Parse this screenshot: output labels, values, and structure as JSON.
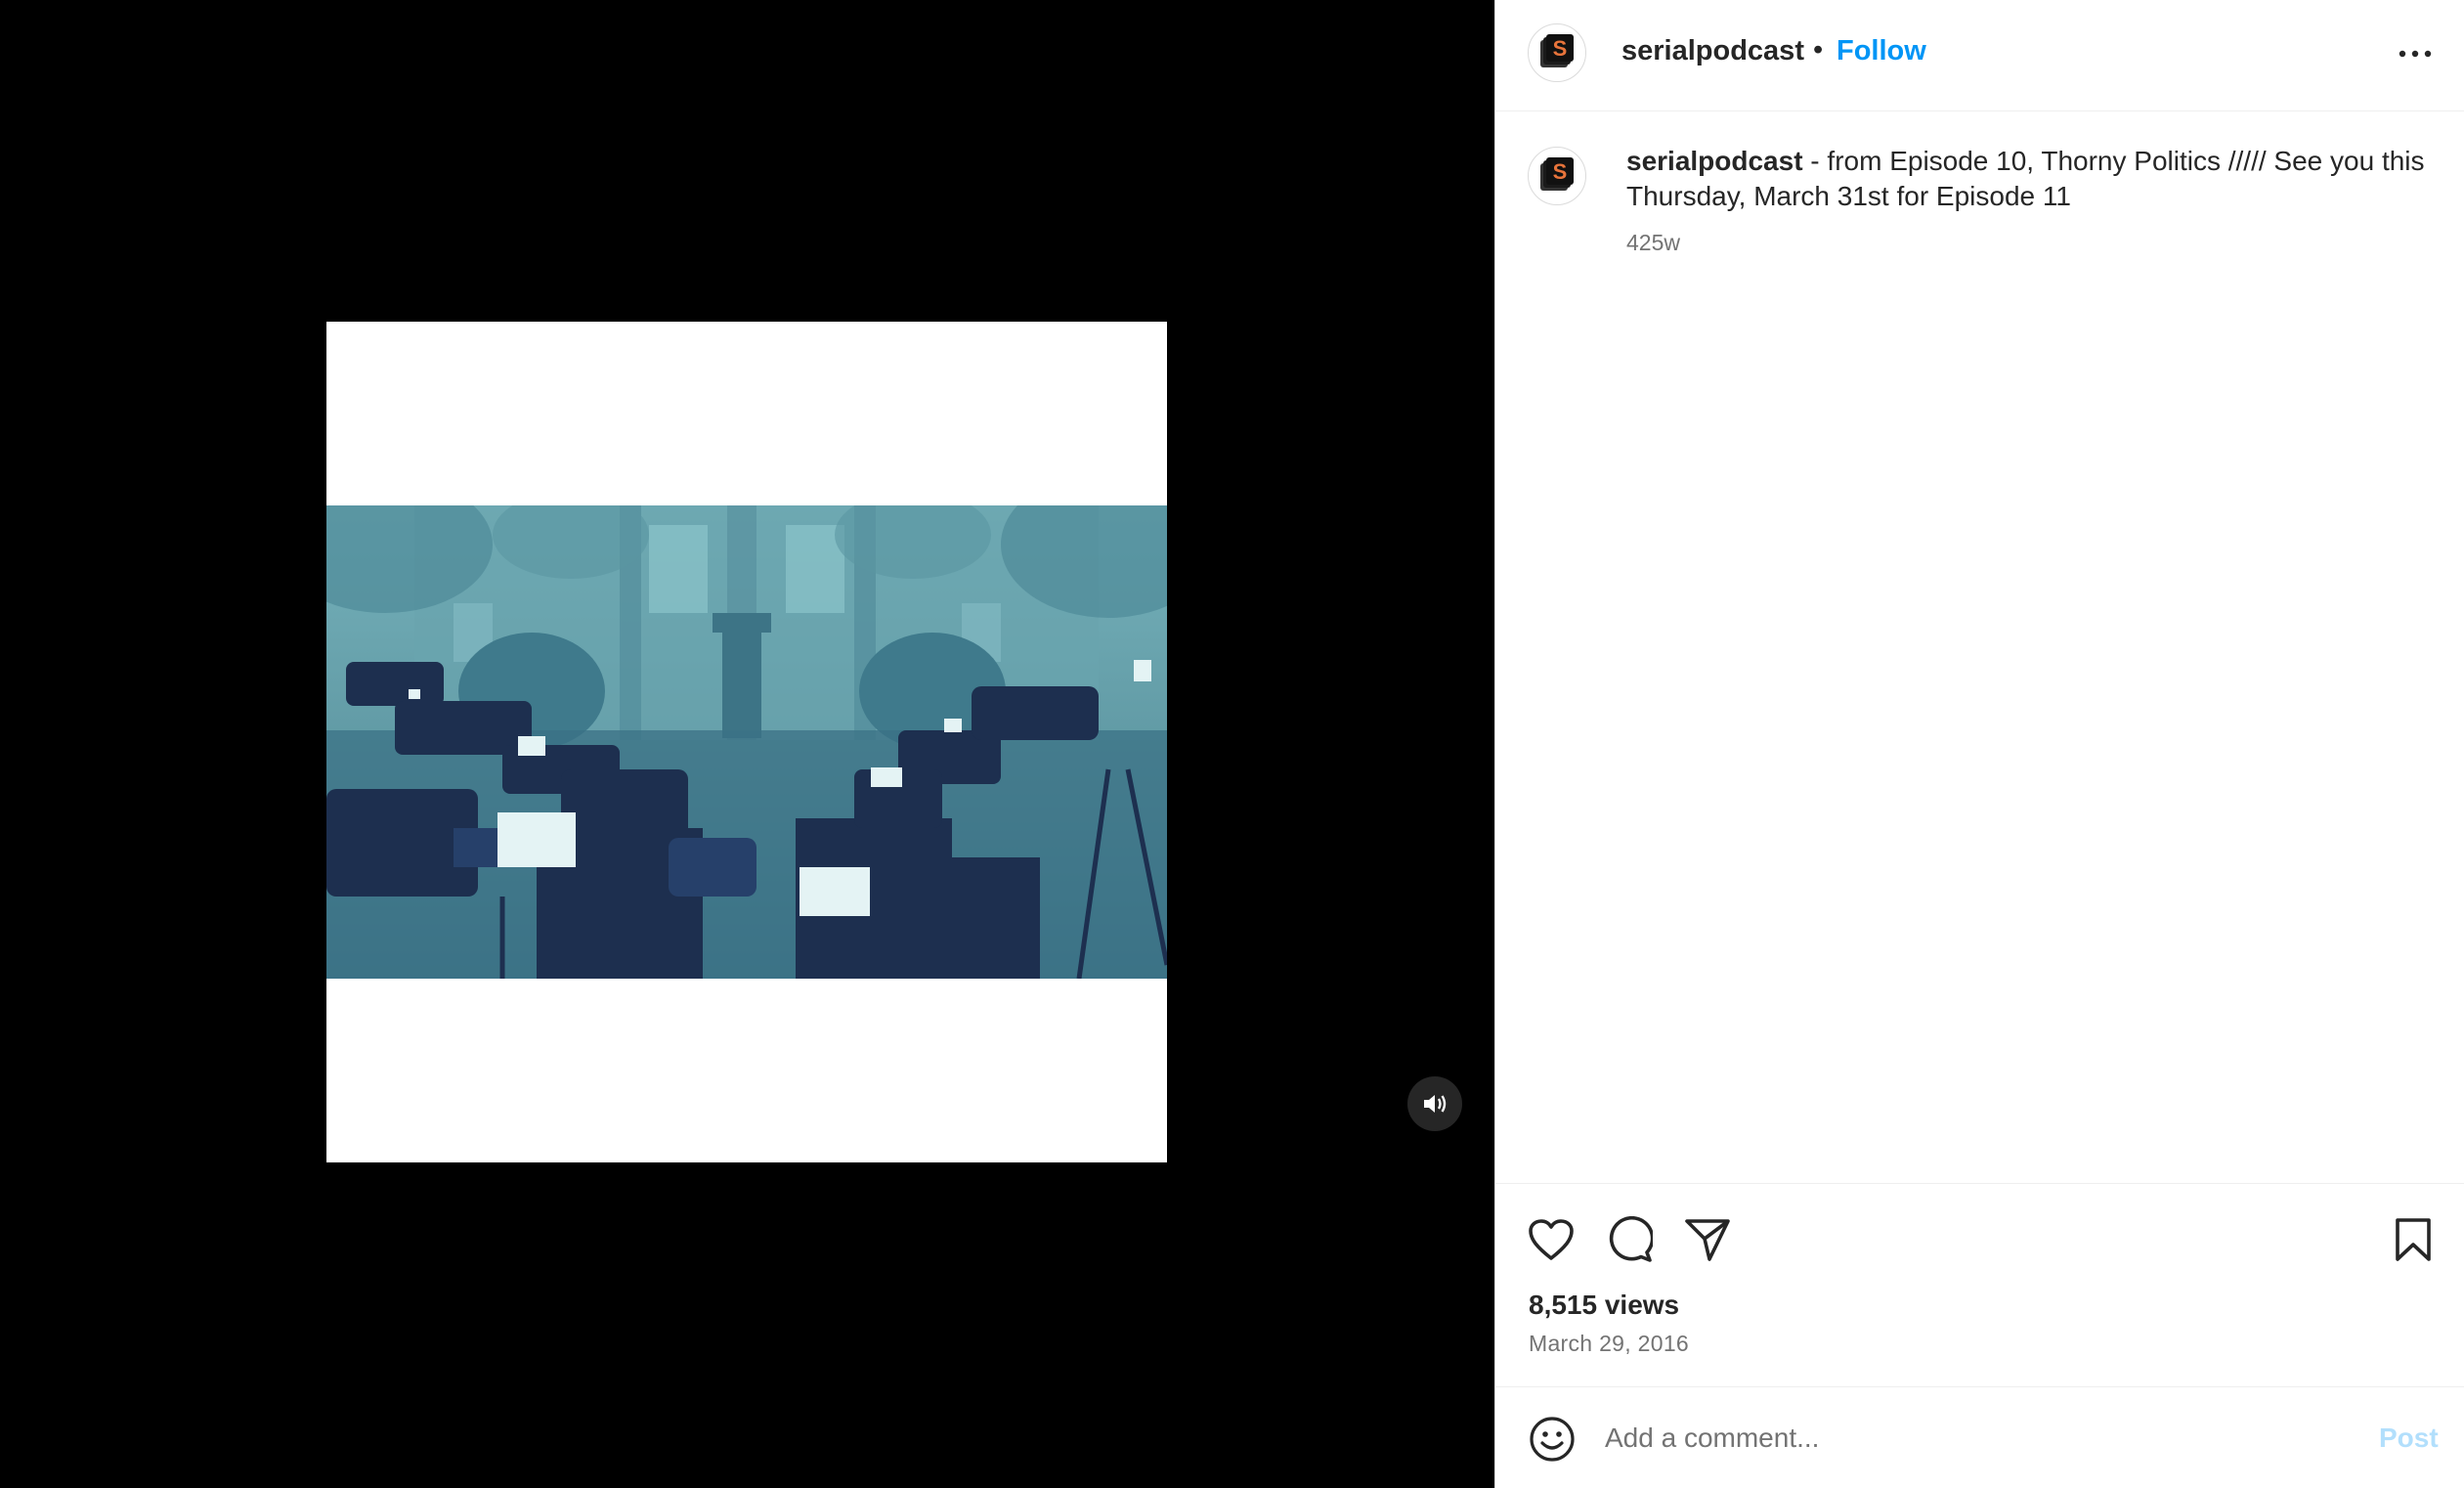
{
  "post": {
    "username": "serialpodcast",
    "follow_label": "Follow",
    "separator": "•",
    "caption_text": " - from Episode 10, Thorny Politics ///// See you this Thursday, March 31st for Episode 11",
    "caption_time": "425w",
    "views": "8,515 views",
    "date": "March 29, 2016"
  },
  "avatar": {
    "letter": "S",
    "accent": "#e8743b"
  },
  "comment": {
    "placeholder": "Add a comment...",
    "post_label": "Post"
  },
  "icons": {
    "more": "more-options-icon",
    "mute": "volume-icon",
    "like": "heart-icon",
    "comment": "comment-icon",
    "share": "share-icon",
    "save": "bookmark-icon",
    "emoji": "emoji-icon"
  },
  "colors": {
    "link": "#0095f6",
    "post_disabled": "#b2dffc",
    "secondary_text": "#737373",
    "scene_tint": "#5e97a2"
  }
}
